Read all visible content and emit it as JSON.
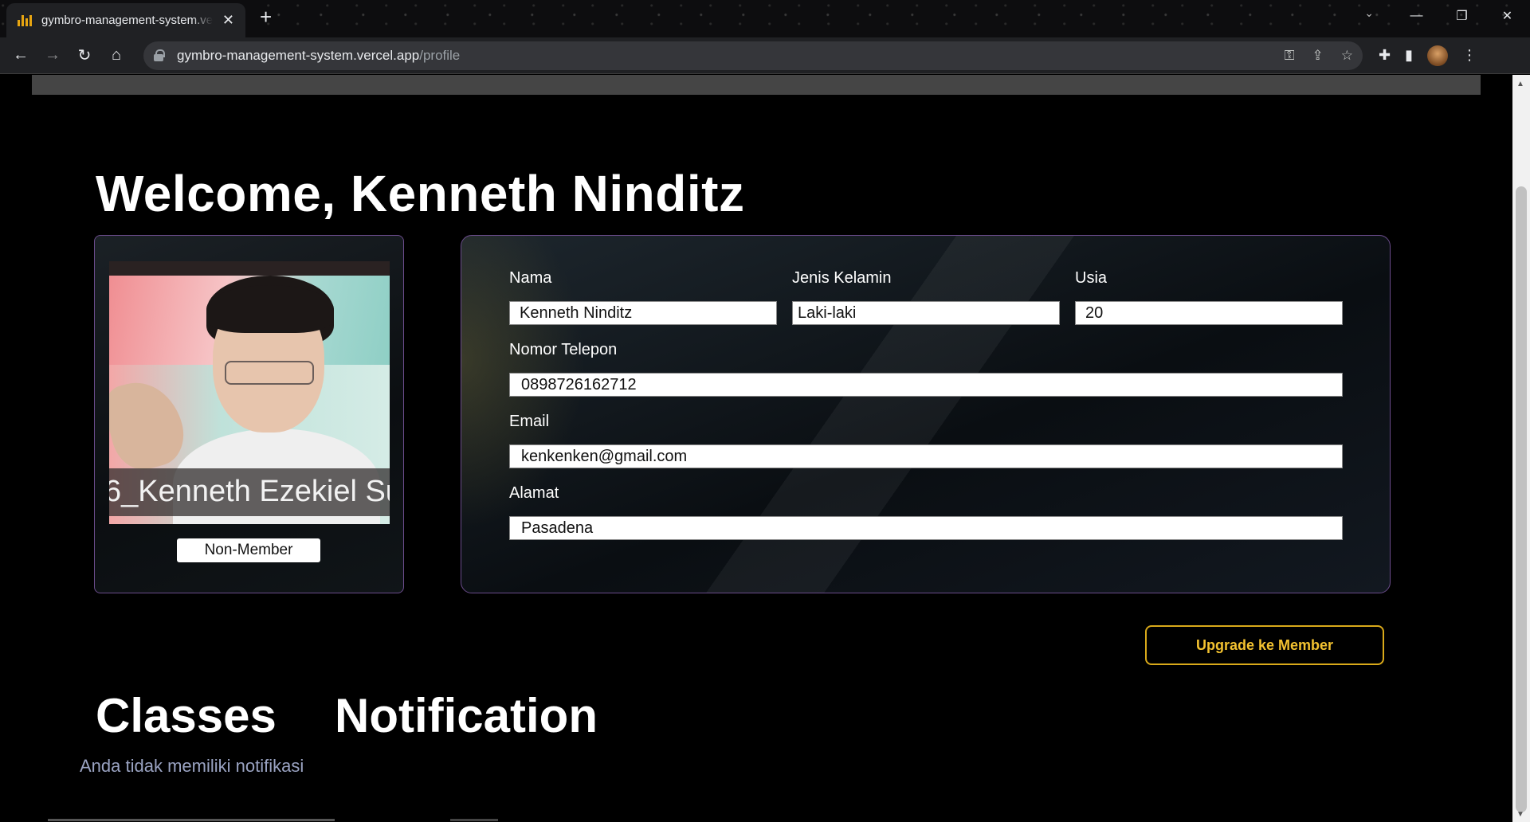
{
  "browser": {
    "tab_title": "gymbro-management-system.vercel.app",
    "url_host": "gymbro-management-system.vercel.app",
    "url_path": "/profile"
  },
  "page": {
    "welcome": "Welcome, Kenneth Ninditz",
    "profile_card": {
      "photo_caption": "6_Kenneth Ezekiel Su",
      "membership_status": "Non-Member"
    },
    "fields": {
      "nama": {
        "label": "Nama",
        "value": "Kenneth Ninditz"
      },
      "jenis_kelamin": {
        "label": "Jenis Kelamin",
        "value": "Laki-laki"
      },
      "usia": {
        "label": "Usia",
        "value": "20"
      },
      "nomor_telepon": {
        "label": "Nomor Telepon",
        "value": "0898726162712"
      },
      "email": {
        "label": "Email",
        "value": "kenkenken@gmail.com"
      },
      "alamat": {
        "label": "Alamat",
        "value": "Pasadena"
      }
    },
    "upgrade_button": "Upgrade ke Member",
    "sections": {
      "classes": "Classes",
      "notification": "Notification",
      "empty_notification": "Anda tidak memiliki notifikasi"
    }
  },
  "colors": {
    "accent_gold": "#d9a91a",
    "card_border": "#6b4c8c",
    "muted_text": "#9aa3c2"
  }
}
